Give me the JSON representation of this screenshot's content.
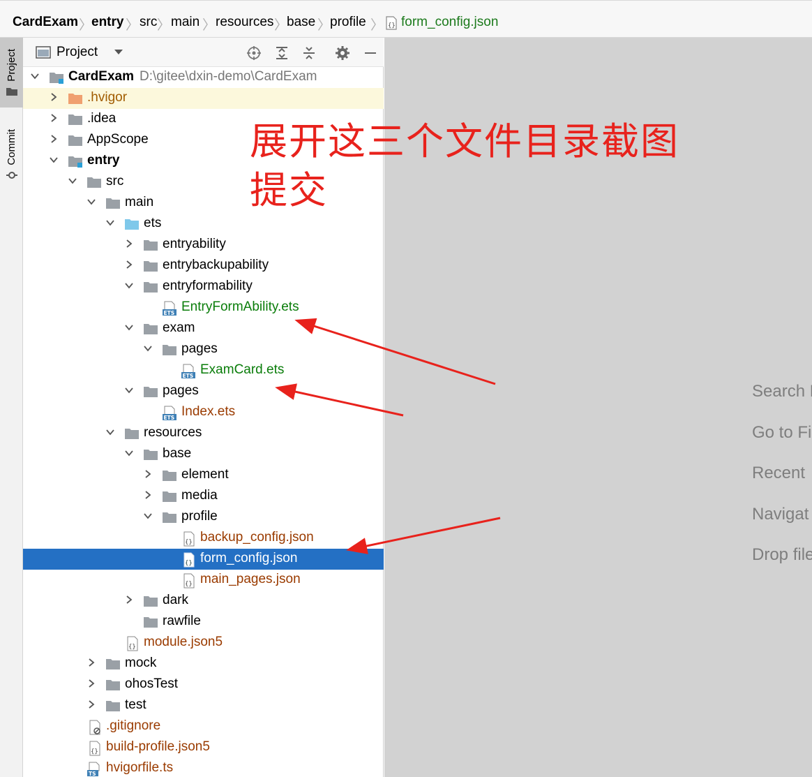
{
  "breadcrumb": {
    "items": [
      "CardExam",
      "entry",
      "src",
      "main",
      "resources",
      "base",
      "profile",
      "form_config.json"
    ]
  },
  "toolwindow": {
    "project_tab": "Project",
    "commit_tab": "Commit"
  },
  "project_panel": {
    "title": "Project",
    "icons": [
      "crosshair-icon",
      "expand-all-icon",
      "collapse-all-icon",
      "gear-icon",
      "minimize-icon"
    ]
  },
  "tree": {
    "root_name": "CardExam",
    "root_path": "D:\\gitee\\dxin-demo\\CardExam",
    "hvigor": ".hvigor",
    "idea": ".idea",
    "appscope": "AppScope",
    "entry": "entry",
    "src": "src",
    "main": "main",
    "ets": "ets",
    "entryability": "entryability",
    "entrybackupability": "entrybackupability",
    "entryformability": "entryformability",
    "entryformability_file": "EntryFormAbility.ets",
    "exam": "exam",
    "exam_pages": "pages",
    "examcard_file": "ExamCard.ets",
    "pages": "pages",
    "index_file": "Index.ets",
    "resources": "resources",
    "base": "base",
    "element": "element",
    "media": "media",
    "profile": "profile",
    "backup_config": "backup_config.json",
    "form_config": "form_config.json",
    "main_pages": "main_pages.json",
    "dark": "dark",
    "rawfile": "rawfile",
    "module_json5": "module.json5",
    "mock": "mock",
    "ohostest": "ohosTest",
    "test": "test",
    "gitignore": ".gitignore",
    "build_profile": "build-profile.json5",
    "hvigorfile": "hvigorfile.ts"
  },
  "editor_hints": [
    "Search E",
    "Go to Fi",
    "Recent",
    "Navigat",
    "Drop file"
  ],
  "annotation": {
    "line1": "展开这三个文件目录截图",
    "line2": "提交",
    "color": "#e8221c"
  },
  "colors": {
    "selection": "#2470c4",
    "new_file_green": "#0a7d0a",
    "modified_brown": "#9a3b00"
  }
}
